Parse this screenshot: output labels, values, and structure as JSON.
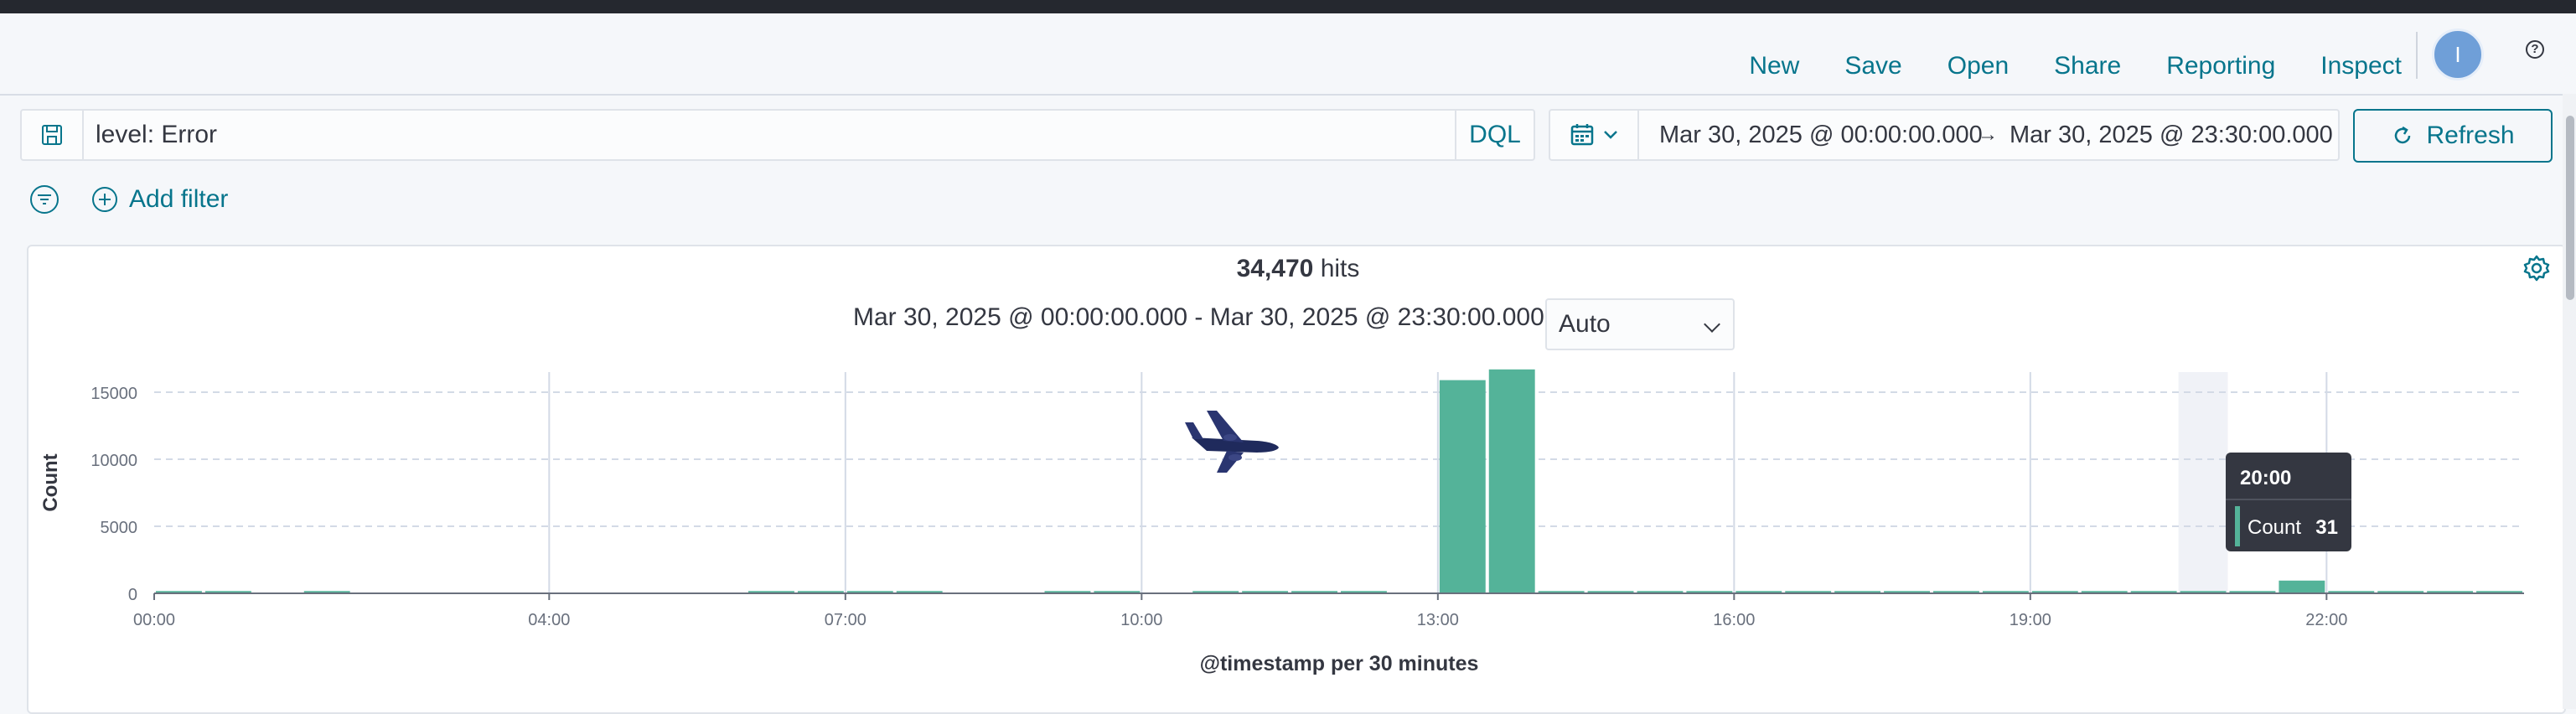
{
  "menu": [
    "New",
    "Save",
    "Open",
    "Share",
    "Reporting",
    "Inspect"
  ],
  "user": {
    "initial": "I"
  },
  "help_label": "?",
  "query": {
    "text": "level: Error",
    "language": "DQL"
  },
  "date_range": {
    "start": "Mar 30, 2025 @ 00:00:00.000",
    "arrow": "→",
    "end": "Mar 30, 2025 @ 23:30:00.000"
  },
  "refresh_label": "Refresh",
  "add_filter_label": "Add filter",
  "hits": {
    "count": "34,470",
    "label": "hits"
  },
  "interval_text": "Mar 30, 2025 @ 00:00:00.000 - Mar 30, 2025 @ 23:30:00.000 per",
  "interval_value": "Auto",
  "colors": {
    "accent": "#07758c",
    "bar": "#54b399",
    "tooltip_bg": "#343741"
  },
  "chart_data": {
    "type": "bar",
    "ylabel": "Count",
    "xlabel": "@timestamp per 30 minutes",
    "ylim": [
      0,
      16500
    ],
    "yticks": [
      0,
      5000,
      10000,
      15000
    ],
    "ytick_labels": [
      "0",
      "5000",
      "10000",
      "15000"
    ],
    "xticks": [
      0,
      8,
      14,
      20,
      26,
      32,
      38,
      44
    ],
    "xtick_labels": [
      "00:00",
      "04:00",
      "07:00",
      "10:00",
      "13:00",
      "16:00",
      "19:00",
      "22:00"
    ],
    "bin_count": 48,
    "values": [
      170,
      170,
      0,
      170,
      0,
      0,
      0,
      0,
      0,
      0,
      0,
      0,
      170,
      170,
      170,
      170,
      0,
      0,
      170,
      170,
      0,
      170,
      170,
      170,
      170,
      0,
      15900,
      16700,
      170,
      170,
      170,
      170,
      170,
      170,
      170,
      170,
      170,
      170,
      170,
      170,
      170,
      170,
      170,
      950,
      170,
      170,
      170,
      170
    ],
    "grid": "dashed horizontal, solid vertical at tick positions",
    "highlight_bin": 41,
    "tooltip": {
      "title": "20:00",
      "series": "Count",
      "value": "31"
    }
  }
}
